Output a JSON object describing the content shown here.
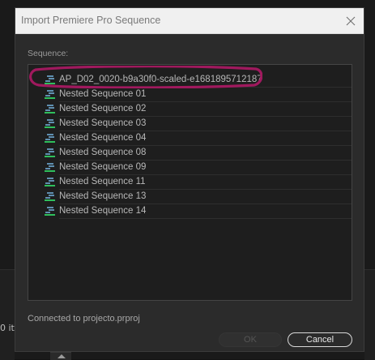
{
  "dialog": {
    "title": "Import Premiere Pro Sequence",
    "sequence_label": "Sequence:",
    "status": "Connected to projecto.prproj",
    "ok_label": "OK",
    "cancel_label": "Cancel"
  },
  "sequences": [
    {
      "label": "AP_D02_0020-b9a30f0-scaled-e1681895712187",
      "icon": "sequence-icon",
      "highlighted": true
    },
    {
      "label": "Nested Sequence 01",
      "icon": "sequence-icon"
    },
    {
      "label": "Nested Sequence 02",
      "icon": "sequence-icon"
    },
    {
      "label": "Nested Sequence 03",
      "icon": "sequence-icon"
    },
    {
      "label": "Nested Sequence 04",
      "icon": "sequence-icon"
    },
    {
      "label": "Nested Sequence 08",
      "icon": "sequence-icon"
    },
    {
      "label": "Nested Sequence 09",
      "icon": "sequence-icon"
    },
    {
      "label": "Nested Sequence 11",
      "icon": "sequence-icon"
    },
    {
      "label": "Nested Sequence 13",
      "icon": "sequence-icon"
    },
    {
      "label": "Nested Sequence 14",
      "icon": "sequence-icon"
    }
  ],
  "background": {
    "left_partial_text": "0 ite"
  },
  "colors": {
    "highlight_annotation": "#a0195e",
    "sequence_icon_track": "#2fbf5c",
    "sequence_icon_bars": "#5f8fb0"
  }
}
